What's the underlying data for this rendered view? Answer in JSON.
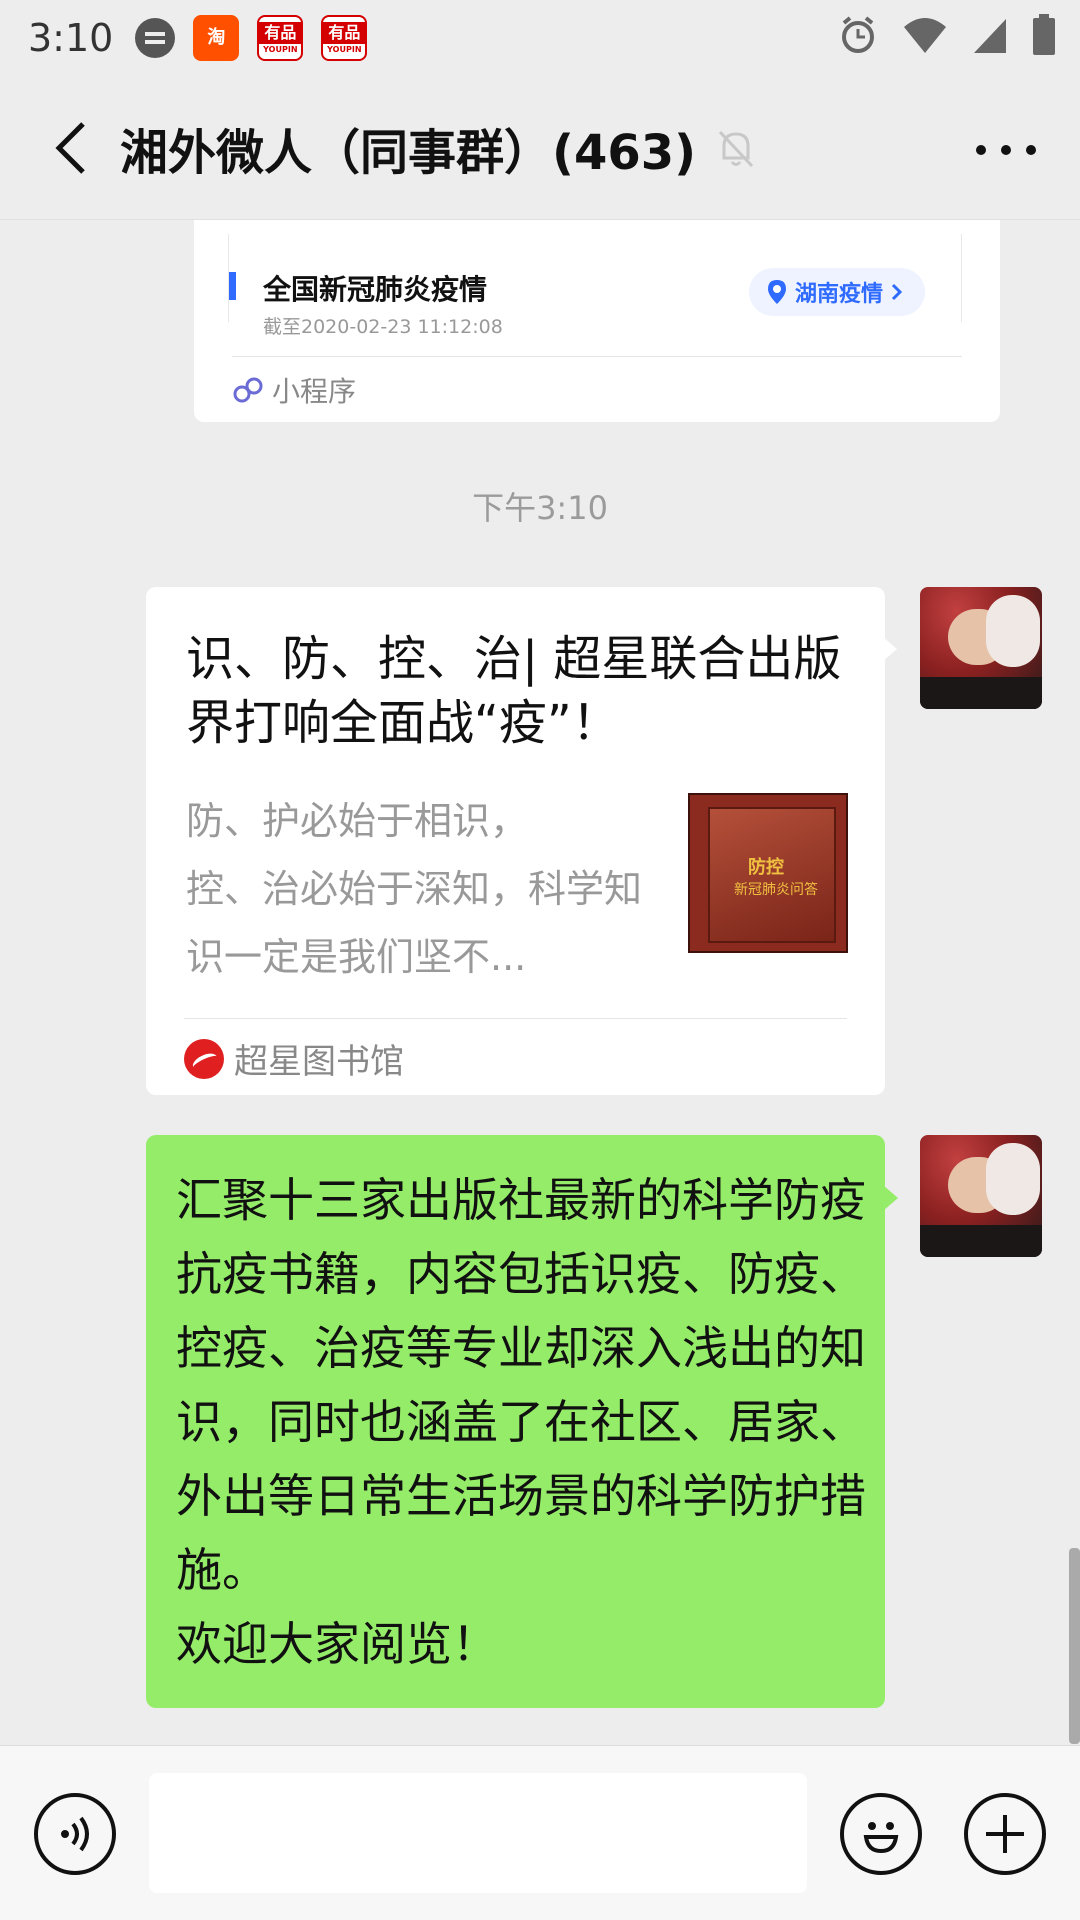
{
  "status_bar": {
    "time": "3:10",
    "app_icons": [
      {
        "name": "taobao-app-icon",
        "label": "淘"
      },
      {
        "name": "youpin-app-icon",
        "label": "有品",
        "sub": "YOUPIN"
      },
      {
        "name": "youpin-app-icon",
        "label": "有品",
        "sub": "YOUPIN"
      }
    ]
  },
  "header": {
    "title": "湘外微人（同事群）(463)"
  },
  "mini_program_card": {
    "headline": "全国新冠肺炎疫情",
    "updated": "截至2020-02-23 11:12:08",
    "chip_label": "湖南疫情",
    "source_label": "小程序"
  },
  "timestamp": "下午3:10",
  "article_card": {
    "title": "识、防、控、治| 超星联合出版界打响全面战“疫”！",
    "description": "防、护必始于相识，\n控、治必始于深知，科学知识一定是我们坚不...",
    "thumbnail_text_1": "防控",
    "thumbnail_text_2": "新冠肺炎问答",
    "source": "超星图书馆"
  },
  "text_message": {
    "content": "汇聚十三家出版社最新的科学防疫抗疫书籍，内容包括识疫、防疫、控疫、治疫等专业却深入浅出的知识，同时也涵盖了在社区、居家、外出等日常生活场景的科学防护措施。\n欢迎大家阅览！"
  },
  "input_bar": {
    "value": ""
  },
  "colors": {
    "background": "#ededed",
    "bubble_green": "#95ec69",
    "link_blue": "#2f6bff"
  }
}
